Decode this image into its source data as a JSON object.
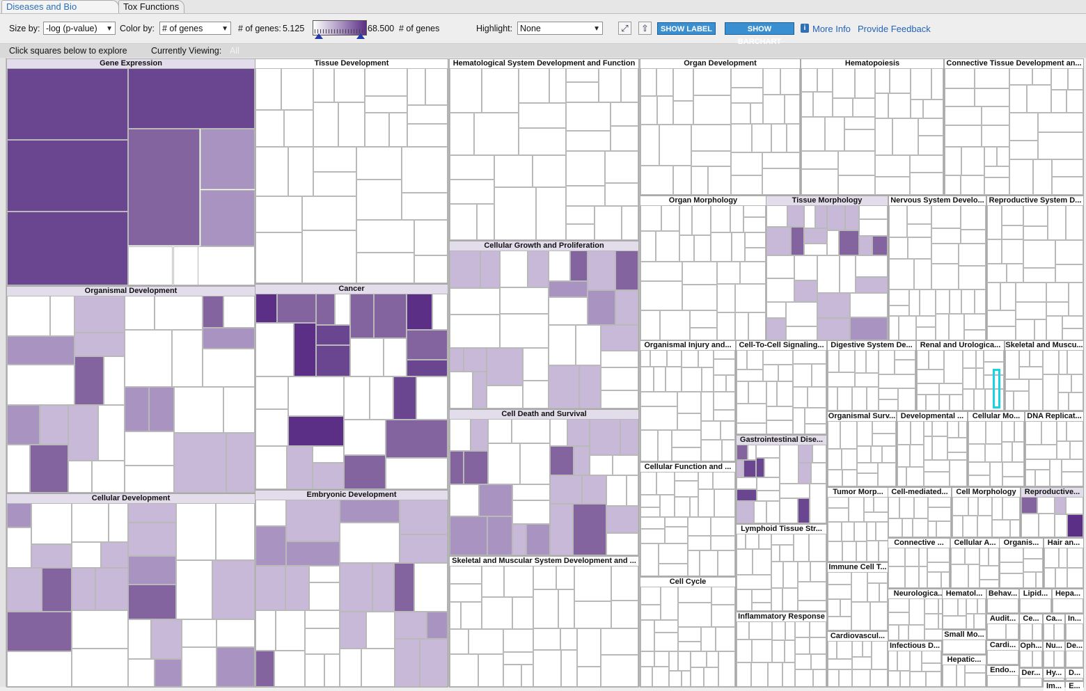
{
  "tabs": [
    {
      "label": "Diseases and Bio Functions",
      "active": true
    },
    {
      "label": "Tox Functions",
      "active": false
    }
  ],
  "toolbar": {
    "size_by_label": "Size by:",
    "size_by_value": "-log (p-value)",
    "color_by_label": "Color by:",
    "color_by_value": "# of genes",
    "range_label_left": "# of genes:",
    "range_min": "5.125",
    "range_max": "68.500",
    "range_label_right": "# of genes",
    "highlight_label": "Highlight:",
    "highlight_value": "None",
    "show_label_button": "SHOW LABEL",
    "show_barchart_button": "SHOW BARCHART",
    "more_info_link": "More Info",
    "feedback_link": "Provide Feedback"
  },
  "statusbar": {
    "hint": "Click squares below to explore",
    "viewing_label": "Currently Viewing:",
    "viewing_value": "All"
  },
  "colors": {
    "accent_link": "#2464b8",
    "button_bg": "#3a8fd0",
    "scale_low": "#ffffff",
    "scale_high": "#5b2f86",
    "selection": "#19d3e0"
  },
  "icons": {
    "fit_screen": "fit-screen-icon",
    "up_level": "up-level-icon",
    "info": "info-icon",
    "dropdown": "chevron-down-icon"
  },
  "treemap": {
    "groups": [
      {
        "title": "Gene Expression",
        "shade": 4
      },
      {
        "title": "Tissue Development",
        "shade": 0
      },
      {
        "title": "Hematological System Development and Function",
        "shade": 0
      },
      {
        "title": "Organ Development",
        "shade": 0
      },
      {
        "title": "Hematopoiesis",
        "shade": 0
      },
      {
        "title": "Connective Tissue Development an...",
        "shade": 0
      },
      {
        "title": "Organ Morphology",
        "shade": 0
      },
      {
        "title": "Tissue Morphology",
        "shade": 1
      },
      {
        "title": "Nervous System Develo...",
        "shade": 0
      },
      {
        "title": "Reproductive System D...",
        "shade": 0
      },
      {
        "title": "Cellular Growth and Proliferation",
        "shade": 1
      },
      {
        "title": "Organismal Development",
        "shade": 1
      },
      {
        "title": "Cancer",
        "shade": 1
      },
      {
        "title": "Organismal Injury and...",
        "shade": 0
      },
      {
        "title": "Cell-To-Cell Signaling...",
        "shade": 0
      },
      {
        "title": "Digestive System De...",
        "shade": 0
      },
      {
        "title": "Renal and Urologica...",
        "shade": 0
      },
      {
        "title": "Skeletal and Muscu...",
        "shade": 0
      },
      {
        "title": "Organismal Surv...",
        "shade": 0
      },
      {
        "title": "Developmental ...",
        "shade": 0
      },
      {
        "title": "Cellular Mo...",
        "shade": 0
      },
      {
        "title": "DNA Replicat...",
        "shade": 0
      },
      {
        "title": "Cell Death and Survival",
        "shade": 1
      },
      {
        "title": "Gastrointestinal Dise...",
        "shade": 1
      },
      {
        "title": "Cellular Function and ...",
        "shade": 0
      },
      {
        "title": "Tumor Morp...",
        "shade": 0
      },
      {
        "title": "Cell-mediated...",
        "shade": 0
      },
      {
        "title": "Cell Morphology",
        "shade": 0
      },
      {
        "title": "Reproductive...",
        "shade": 1
      },
      {
        "title": "Cellular Development",
        "shade": 1
      },
      {
        "title": "Embryonic Development",
        "shade": 1
      },
      {
        "title": "Lymphoid Tissue Str...",
        "shade": 0
      },
      {
        "title": "Connective ...",
        "shade": 0
      },
      {
        "title": "Cellular A...",
        "shade": 0
      },
      {
        "title": "Organis...",
        "shade": 0
      },
      {
        "title": "Hair an...",
        "shade": 0
      },
      {
        "title": "Skeletal and Muscular System Development and ...",
        "shade": 0
      },
      {
        "title": "Immune Cell T...",
        "shade": 0
      },
      {
        "title": "Cell Cycle",
        "shade": 0
      },
      {
        "title": "Neurologica...",
        "shade": 0
      },
      {
        "title": "Hematol...",
        "shade": 0
      },
      {
        "title": "Behav...",
        "shade": 0
      },
      {
        "title": "Lipid...",
        "shade": 0
      },
      {
        "title": "Hepa...",
        "shade": 0
      },
      {
        "title": "Inflammatory Response",
        "shade": 0
      },
      {
        "title": "Audit...",
        "shade": 0
      },
      {
        "title": "Ce...",
        "shade": 0
      },
      {
        "title": "Ca...",
        "shade": 0
      },
      {
        "title": "In...",
        "shade": 0
      },
      {
        "title": "Cardiovascul...",
        "shade": 0
      },
      {
        "title": "Small Mo...",
        "shade": 0
      },
      {
        "title": "Cardi...",
        "shade": 0
      },
      {
        "title": "Oph...",
        "shade": 0
      },
      {
        "title": "Nu...",
        "shade": 0
      },
      {
        "title": "De...",
        "shade": 0
      },
      {
        "title": "Infectious D...",
        "shade": 0
      },
      {
        "title": "Endo...",
        "shade": 0
      },
      {
        "title": "Hy...",
        "shade": 0
      },
      {
        "title": "D...",
        "shade": 0
      },
      {
        "title": "Hepatic...",
        "shade": 0
      },
      {
        "title": "Der...",
        "shade": 0
      },
      {
        "title": "Im...",
        "shade": 0
      },
      {
        "title": "E...",
        "shade": 0
      }
    ]
  }
}
